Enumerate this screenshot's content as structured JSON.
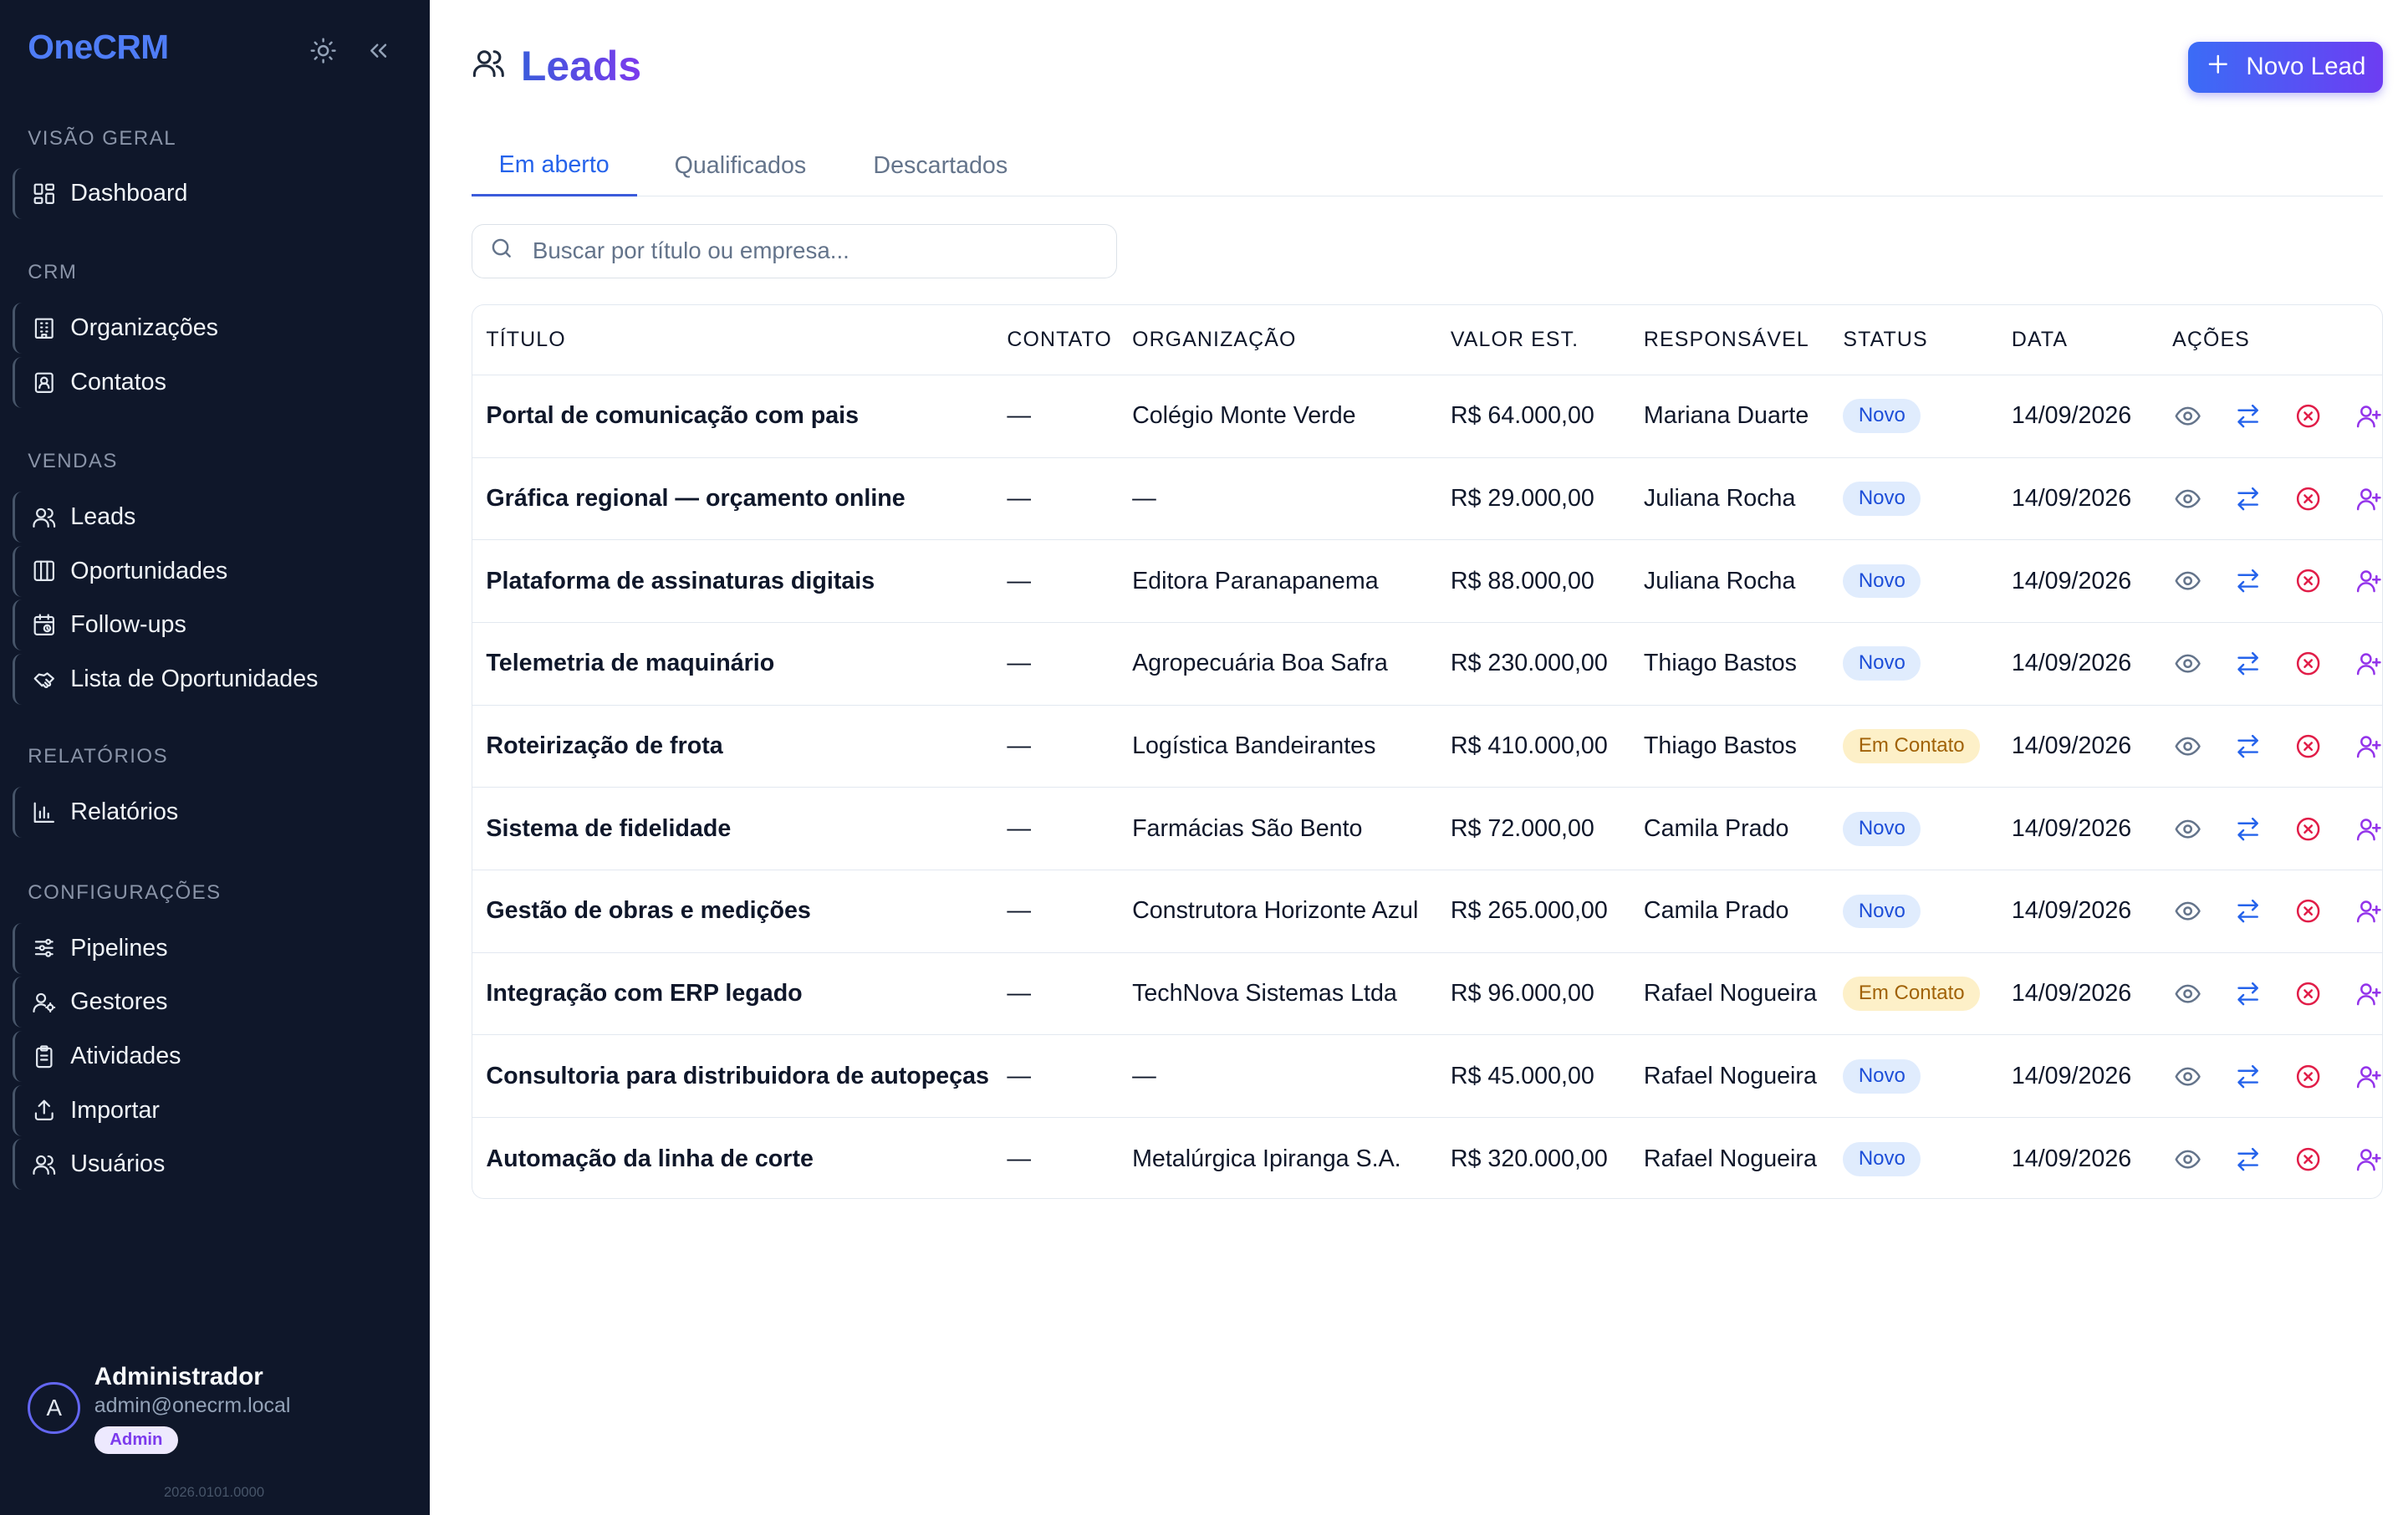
{
  "app": {
    "brand": "OneCRM",
    "version": "2026.0101.0000"
  },
  "sidebar": {
    "sections": [
      {
        "label": "VISÃO GERAL",
        "items": [
          {
            "label": "Dashboard",
            "icon": "dashboard-icon"
          }
        ]
      },
      {
        "label": "CRM",
        "items": [
          {
            "label": "Organizações",
            "icon": "building-icon"
          },
          {
            "label": "Contatos",
            "icon": "contact-card-icon"
          }
        ]
      },
      {
        "label": "VENDAS",
        "items": [
          {
            "label": "Leads",
            "icon": "users-icon"
          },
          {
            "label": "Oportunidades",
            "icon": "columns-icon"
          },
          {
            "label": "Follow-ups",
            "icon": "calendar-clock-icon"
          },
          {
            "label": "Lista de Oportunidades",
            "icon": "handshake-icon"
          }
        ]
      },
      {
        "label": "RELATÓRIOS",
        "items": [
          {
            "label": "Relatórios",
            "icon": "bar-chart-icon"
          }
        ]
      },
      {
        "label": "CONFIGURAÇÕES",
        "items": [
          {
            "label": "Pipelines",
            "icon": "pipeline-icon"
          },
          {
            "label": "Gestores",
            "icon": "user-cog-icon"
          },
          {
            "label": "Atividades",
            "icon": "clipboard-icon"
          },
          {
            "label": "Importar",
            "icon": "upload-icon"
          },
          {
            "label": "Usuários",
            "icon": "users-icon"
          }
        ]
      }
    ],
    "user": {
      "initial": "A",
      "name": "Administrador",
      "email": "admin@onecrm.local",
      "role": "Admin"
    }
  },
  "header": {
    "title": "Leads",
    "new_button": "Novo Lead"
  },
  "tabs": [
    "Em aberto",
    "Qualificados",
    "Descartados"
  ],
  "active_tab": "Em aberto",
  "search": {
    "placeholder": "Buscar por título ou empresa...",
    "value": ""
  },
  "table": {
    "columns": [
      "TÍTULO",
      "CONTATO",
      "ORGANIZAÇÃO",
      "VALOR EST.",
      "RESPONSÁVEL",
      "STATUS",
      "DATA",
      "AÇÕES"
    ],
    "rows": [
      {
        "title": "Portal de comunicação com pais",
        "contact": "—",
        "org": "Colégio Monte Verde",
        "value": "R$ 64.000,00",
        "owner": "Mariana Duarte",
        "status": "Novo",
        "date": "14/09/2026"
      },
      {
        "title": "Gráfica regional — orçamento online",
        "contact": "—",
        "org": "—",
        "value": "R$ 29.000,00",
        "owner": "Juliana Rocha",
        "status": "Novo",
        "date": "14/09/2026"
      },
      {
        "title": "Plataforma de assinaturas digitais",
        "contact": "—",
        "org": "Editora Paranapanema",
        "value": "R$ 88.000,00",
        "owner": "Juliana Rocha",
        "status": "Novo",
        "date": "14/09/2026"
      },
      {
        "title": "Telemetria de maquinário",
        "contact": "—",
        "org": "Agropecuária Boa Safra",
        "value": "R$ 230.000,00",
        "owner": "Thiago Bastos",
        "status": "Novo",
        "date": "14/09/2026"
      },
      {
        "title": "Roteirização de frota",
        "contact": "—",
        "org": "Logística Bandeirantes",
        "value": "R$ 410.000,00",
        "owner": "Thiago Bastos",
        "status": "Em Contato",
        "date": "14/09/2026"
      },
      {
        "title": "Sistema de fidelidade",
        "contact": "—",
        "org": "Farmácias São Bento",
        "value": "R$ 72.000,00",
        "owner": "Camila Prado",
        "status": "Novo",
        "date": "14/09/2026"
      },
      {
        "title": "Gestão de obras e medições",
        "contact": "—",
        "org": "Construtora Horizonte Azul",
        "value": "R$ 265.000,00",
        "owner": "Camila Prado",
        "status": "Novo",
        "date": "14/09/2026"
      },
      {
        "title": "Integração com ERP legado",
        "contact": "—",
        "org": "TechNova Sistemas Ltda",
        "value": "R$ 96.000,00",
        "owner": "Rafael Nogueira",
        "status": "Em Contato",
        "date": "14/09/2026"
      },
      {
        "title": "Consultoria para distribuidora de autopeças",
        "contact": "—",
        "org": "—",
        "value": "R$ 45.000,00",
        "owner": "Rafael Nogueira",
        "status": "Novo",
        "date": "14/09/2026"
      },
      {
        "title": "Automação da linha de corte",
        "contact": "—",
        "org": "Metalúrgica Ipiranga S.A.",
        "value": "R$ 320.000,00",
        "owner": "Rafael Nogueira",
        "status": "Novo",
        "date": "14/09/2026"
      }
    ]
  },
  "colors": {
    "sidebar_bg": "#0f172a",
    "brand": "#4f7df7",
    "accent": "#4f46e5",
    "status_novo": "#1d4ed8",
    "status_contato": "#a16207",
    "action_view": "#64748b",
    "action_convert": "#2563eb",
    "action_discard": "#e11d48",
    "action_assign": "#9333ea"
  }
}
